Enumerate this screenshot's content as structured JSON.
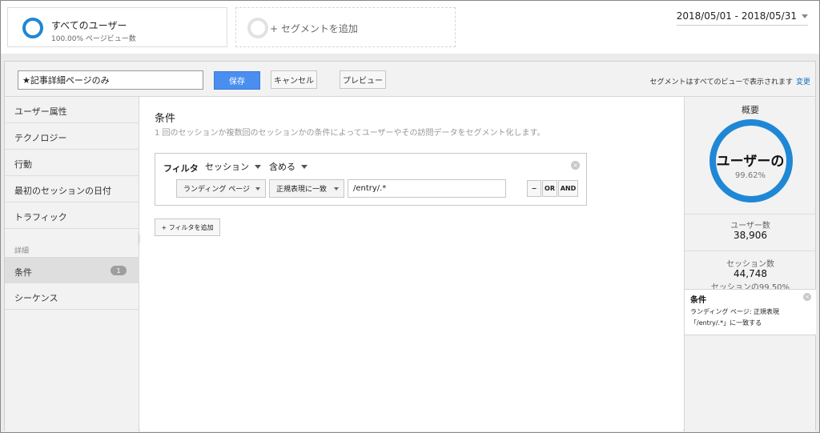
{
  "segments": {
    "active": {
      "title": "すべてのユーザー",
      "subtitle": "100.00% ページビュー数"
    },
    "add_label": "+ セグメントを追加"
  },
  "date_range": "2018/05/01 - 2018/05/31",
  "editor": {
    "name_value": "★記事詳細ページのみ",
    "save_label": "保存",
    "cancel_label": "キャンセル",
    "preview_label": "プレビュー",
    "note": "セグメントはすべてのビューで表示されます",
    "change_link": "変更"
  },
  "nav": {
    "items": [
      {
        "label": "ユーザー属性"
      },
      {
        "label": "テクノロジー"
      },
      {
        "label": "行動"
      },
      {
        "label": "最初のセッションの日付"
      },
      {
        "label": "トラフィック"
      }
    ],
    "detail_label": "詳細",
    "detail_items": [
      {
        "label": "条件",
        "badge": "1"
      },
      {
        "label": "シーケンス"
      }
    ]
  },
  "main": {
    "title": "条件",
    "description": "1 回のセッションか複数回のセッションかの条件によってユーザーやその訪問データをセグメント化します。",
    "filter": {
      "label": "フィルタ",
      "scope": "セッション",
      "mode": "含める",
      "dimension": "ランディング ページ",
      "match_type": "正規表現に一致",
      "value": "/entry/.*",
      "close": "×",
      "minus_label": "−",
      "or_label": "OR",
      "and_label": "AND"
    },
    "add_filter_label": "+ フィルタを追加"
  },
  "summary": {
    "title": "概要",
    "donut_label": "ユーザーの",
    "donut_percent": "99.62%",
    "donut_fraction": 0.9962,
    "users_label": "ユーザー数",
    "users_value": "38,906",
    "sessions_label": "セッション数",
    "sessions_value": "44,748",
    "sessions_percent": "セッションの99.50%",
    "condition_title": "条件",
    "condition_close": "×",
    "condition_line1": "ランディング ページ: 正規表現",
    "condition_line2": "「/entry/.*」に一致する"
  },
  "colors": {
    "accent": "#1f87d6",
    "save_button": "#4a8ff0",
    "link": "#1a73c8"
  }
}
